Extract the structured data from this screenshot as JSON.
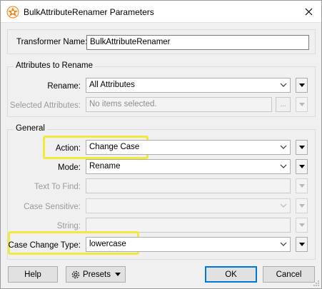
{
  "window": {
    "title": "BulkAttributeRenamer Parameters"
  },
  "transformer": {
    "label": "Transformer Name:",
    "value": "BulkAttributeRenamer"
  },
  "attributes_group": {
    "title": "Attributes to Rename",
    "rename_label": "Rename:",
    "rename_value": "All Attributes",
    "selected_label": "Selected Attributes:",
    "selected_value": "No items selected.",
    "ellipsis": "..."
  },
  "general_group": {
    "title": "General",
    "action_label": "Action:",
    "action_value": "Change Case",
    "mode_label": "Mode:",
    "mode_value": "Rename",
    "text_to_find_label": "Text To Find:",
    "case_sensitive_label": "Case Sensitive:",
    "string_label": "String:",
    "case_change_label": "Case Change Type:",
    "case_change_value": "lowercase"
  },
  "footer": {
    "help": "Help",
    "presets": "Presets",
    "ok": "OK",
    "cancel": "Cancel"
  },
  "colors": {
    "highlight": "#f2ea3a",
    "default_button_border": "#0078d7"
  }
}
